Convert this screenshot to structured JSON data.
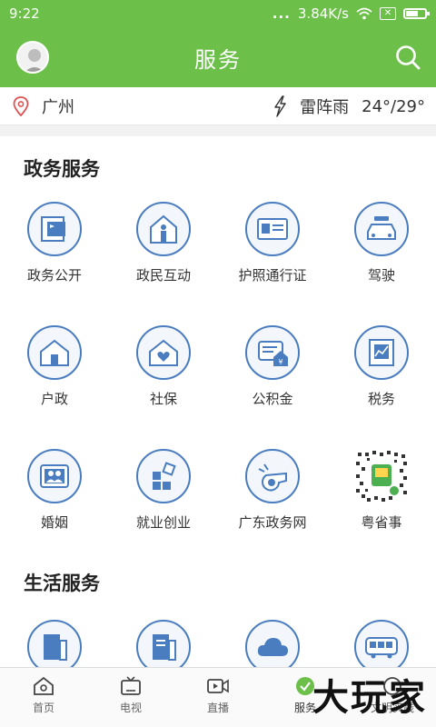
{
  "status": {
    "time": "9:22",
    "speed": "3.84K/s",
    "dots": "...",
    "box": "✕"
  },
  "header": {
    "title": "服务"
  },
  "info": {
    "city": "广州",
    "weather": "雷阵雨",
    "temp": "24°/29°"
  },
  "gov_section": {
    "title": "政务服务",
    "items": [
      {
        "label": "政务公开",
        "icon": "government-flag-icon"
      },
      {
        "label": "政民互动",
        "icon": "house-person-icon"
      },
      {
        "label": "护照通行证",
        "icon": "id-card-icon"
      },
      {
        "label": "驾驶",
        "icon": "car-icon"
      },
      {
        "label": "户政",
        "icon": "house-icon"
      },
      {
        "label": "社保",
        "icon": "heart-house-icon"
      },
      {
        "label": "公积金",
        "icon": "fund-icon"
      },
      {
        "label": "税务",
        "icon": "tax-chart-icon"
      },
      {
        "label": "婚姻",
        "icon": "couple-icon"
      },
      {
        "label": "就业创业",
        "icon": "blocks-icon"
      },
      {
        "label": "广东政务网",
        "icon": "whistle-icon"
      },
      {
        "label": "粤省事",
        "icon": "qr-code-icon"
      }
    ]
  },
  "life_section": {
    "title": "生活服务",
    "items": [
      {
        "label": "",
        "icon": "phone-book-icon"
      },
      {
        "label": "",
        "icon": "document-icon"
      },
      {
        "label": "",
        "icon": "cloud-icon"
      },
      {
        "label": "",
        "icon": "bus-icon"
      }
    ]
  },
  "tabs": [
    {
      "label": "首页",
      "icon": "home-icon"
    },
    {
      "label": "电视",
      "icon": "tv-icon"
    },
    {
      "label": "直播",
      "icon": "live-video-icon"
    },
    {
      "label": "服务",
      "icon": "service-icon"
    },
    {
      "label": "文明实践",
      "icon": "practice-icon"
    }
  ],
  "watermark": "大玩家",
  "colors": {
    "brand_green": "#6cc04a",
    "icon_blue": "#4a7dbf",
    "icon_fill": "#f3f7fc"
  }
}
